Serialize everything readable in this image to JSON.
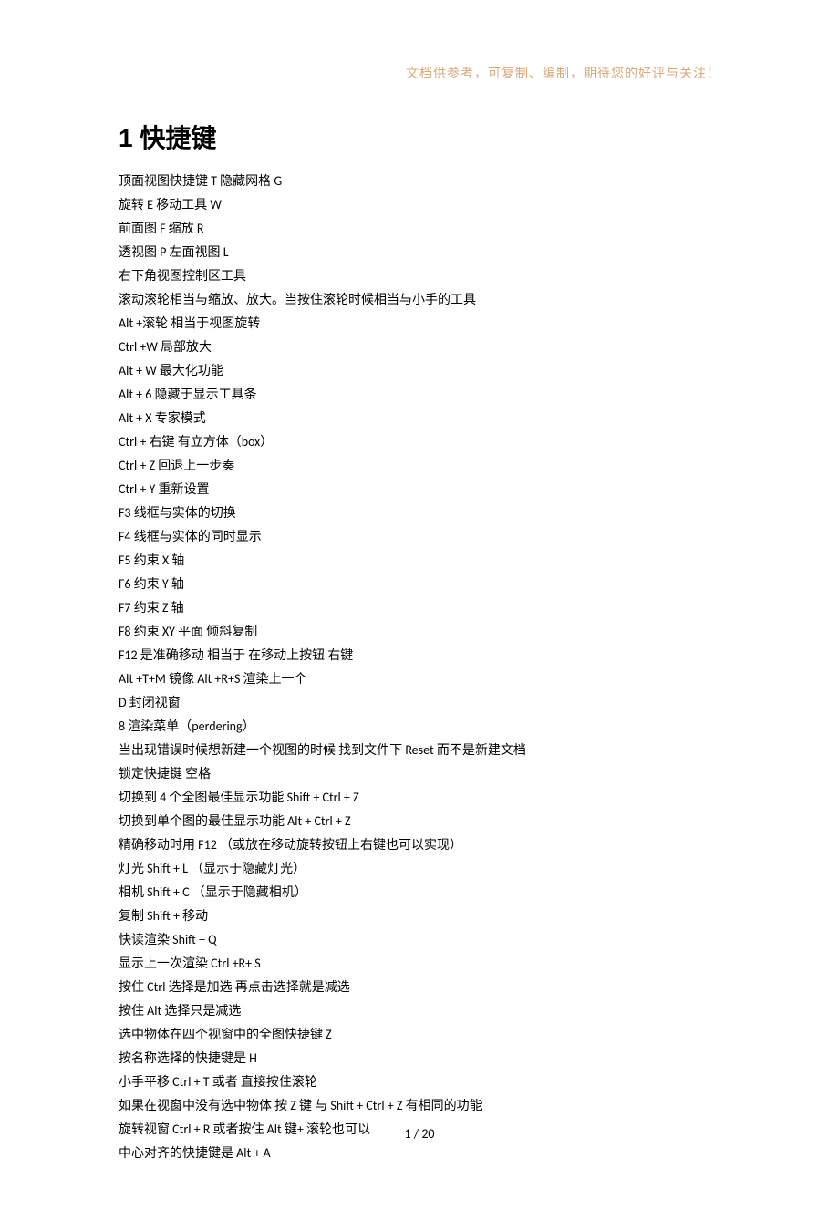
{
  "header_note": "文档供参考，可复制、编制，期待您的好评与关注！",
  "heading": "1 快捷键",
  "lines": [
    "顶面视图快捷键 T 隐藏网格 G",
    "旋转 E 移动工具 W",
    "前面图 F 缩放 R",
    "透视图 P 左面视图 L",
    "右下角视图控制区工具",
    "滚动滚轮相当与缩放、放大。当按住滚轮时候相当与小手的工具",
    "Alt +滚轮 相当于视图旋转",
    "Ctrl +W 局部放大",
    "Alt + W 最大化功能",
    "Alt + 6 隐藏于显示工具条",
    "Alt + X 专家模式",
    "Ctrl + 右键 有立方体（box）",
    "Ctrl + Z 回退上一步奏",
    "Ctrl + Y 重新设置",
    "F3 线框与实体的切换",
    "F4 线框与实体的同时显示",
    "F5 约束 X 轴",
    "F6 约束 Y 轴",
    "F7 约束 Z 轴",
    "F8 约束 XY 平面 倾斜复制",
    "F12 是准确移动 相当于 在移动上按钮 右键",
    "Alt +T+M 镜像 Alt +R+S 渲染上一个",
    "D 封闭视窗",
    "8 渲染菜单（perdering）",
    "当出现错误时候想新建一个视图的时候 找到文件下 Reset 而不是新建文档",
    "锁定快捷键 空格",
    "切换到 4 个全图最佳显示功能 Shift + Ctrl + Z",
    "切换到单个图的最佳显示功能 Alt + Ctrl + Z",
    "精确移动时用 F12 （或放在移动旋转按钮上右键也可以实现）",
    "灯光 Shift + L （显示于隐藏灯光）",
    "相机 Shift + C （显示于隐藏相机）",
    "复制 Shift + 移动",
    "快读渲染 Shift + Q",
    "显示上一次渲染 Ctrl +R+ S",
    "按住 Ctrl 选择是加选 再点击选择就是减选",
    "按住 Alt 选择只是减选",
    "选中物体在四个视窗中的全图快捷键 Z",
    "按名称选择的快捷键是 H",
    "小手平移 Ctrl + T 或者 直接按住滚轮",
    "如果在视窗中没有选中物体 按 Z 键 与 Shift + Ctrl + Z 有相同的功能",
    "旋转视窗 Ctrl + R 或者按住 Alt 键+ 滚轮也可以",
    "中心对齐的快捷键是 Alt + A"
  ],
  "page_number": "1 / 20"
}
